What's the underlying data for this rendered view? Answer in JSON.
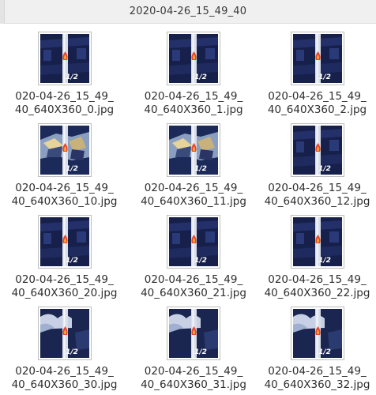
{
  "window": {
    "title": "2020-04-26_15_49_40"
  },
  "files": [
    {
      "line1": "020-04-26_15_49_",
      "line2": "40_640X360_0.jpg",
      "badge": "1/2",
      "variant": "dark"
    },
    {
      "line1": "020-04-26_15_49_",
      "line2": "40_640X360_1.jpg",
      "badge": "1/2",
      "variant": "dark"
    },
    {
      "line1": "020-04-26_15_49_",
      "line2": "40_640X360_2.jpg",
      "badge": "1/2",
      "variant": "dark"
    },
    {
      "line1": "020-04-26_15_49_",
      "line2": "40_640X360_10.jpg",
      "badge": "1/2",
      "variant": "bright"
    },
    {
      "line1": "020-04-26_15_49_",
      "line2": "40_640X360_11.jpg",
      "badge": "1/2",
      "variant": "bright"
    },
    {
      "line1": "020-04-26_15_49_",
      "line2": "40_640X360_12.jpg",
      "badge": "1/2",
      "variant": "dark"
    },
    {
      "line1": "020-04-26_15_49_",
      "line2": "40_640X360_20.jpg",
      "badge": "1/2",
      "variant": "dark"
    },
    {
      "line1": "020-04-26_15_49_",
      "line2": "40_640X360_21.jpg",
      "badge": "1/2",
      "variant": "dark"
    },
    {
      "line1": "020-04-26_15_49_",
      "line2": "40_640X360_22.jpg",
      "badge": "1/2",
      "variant": "dark"
    },
    {
      "line1": "020-04-26_15_49_",
      "line2": "40_640X360_30.jpg",
      "badge": "1/2",
      "variant": "cloud"
    },
    {
      "line1": "020-04-26_15_49_",
      "line2": "40_640X360_31.jpg",
      "badge": "1/2",
      "variant": "cloud"
    },
    {
      "line1": "020-04-26_15_49_",
      "line2": "40_640X360_32.jpg",
      "badge": "1/2",
      "variant": "cloud"
    }
  ]
}
